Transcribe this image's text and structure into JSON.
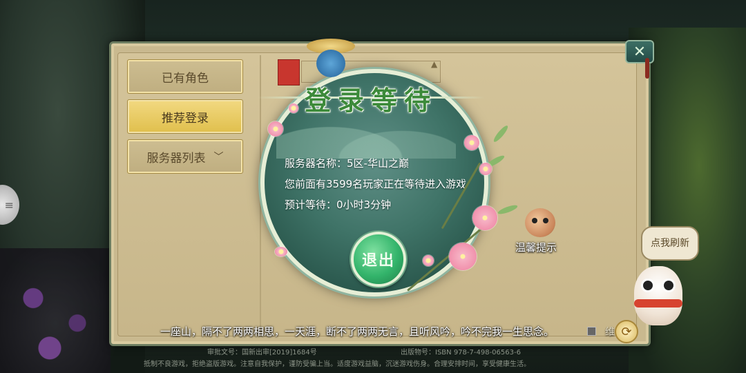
{
  "sidebar": {
    "items": [
      {
        "label": "已有角色"
      },
      {
        "label": "推荐登录"
      },
      {
        "label": "服务器列表",
        "icon": "chevron-down-icon"
      }
    ]
  },
  "dialog": {
    "title": "登录等待",
    "server_name": "服务器名称：5区-华山之巅",
    "queue_text": "您前面有3599名玩家正在等待进入游戏",
    "eta_text": "预计等待：0小时3分钟",
    "exit_label": "退出"
  },
  "tip": {
    "label": "温馨提示"
  },
  "refresh": {
    "label": "点我刷新"
  },
  "footer": {
    "lyric": "一座山，隔不了两两相思，一天涯，断不了两两无言，且听风吟，吟不完我一生思念。",
    "lyric_tail": "维",
    "approval": "审批文号：国新出审[2019]1684号",
    "publication": "出版物号：ISBN 978-7-498-06563-6",
    "health_notice": "抵制不良游戏，拒绝盗版游戏。注意自我保护，谨防受骗上当。适度游戏益脑，沉迷游戏伤身。合理安排时间，享受健康生活。"
  },
  "colors": {
    "panel": "#c9b98f",
    "button": "#e0bf4c",
    "dialog": "#3f7367",
    "title": "#3c8a3a",
    "exit": "#33b46b"
  },
  "icons": {
    "close": "close-icon",
    "cycle": "refresh-cycle-icon",
    "side": "side-menu-icon"
  }
}
